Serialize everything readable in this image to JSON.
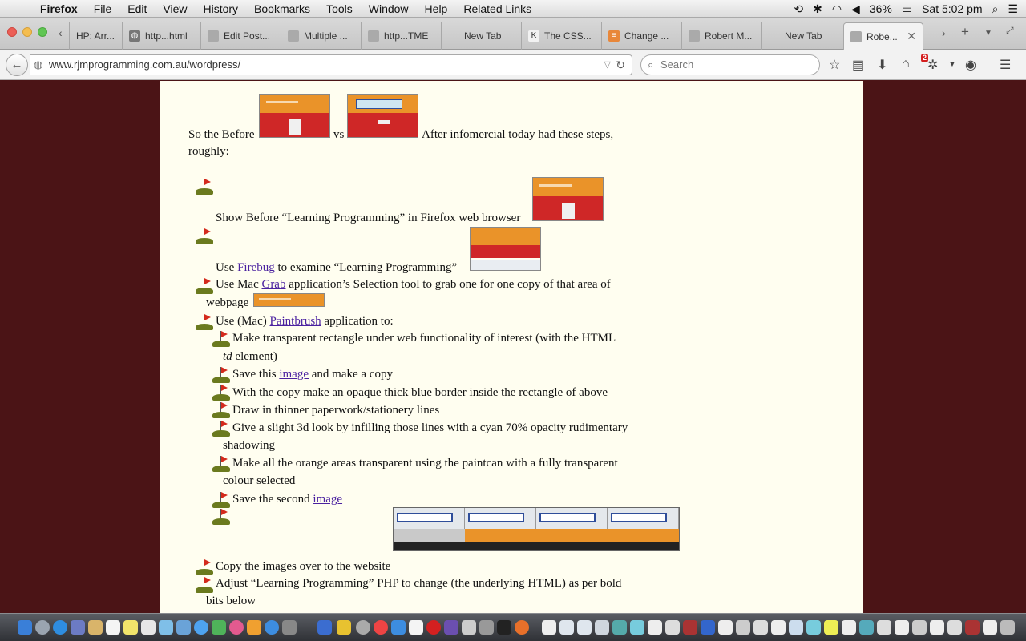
{
  "menubar": {
    "app_name": "Firefox",
    "items": [
      "File",
      "Edit",
      "View",
      "History",
      "Bookmarks",
      "Tools",
      "Window",
      "Help",
      "Related Links"
    ],
    "battery": "36%",
    "clock": "Sat 5:02 pm"
  },
  "tabs": [
    {
      "label": "HP: Arr..."
    },
    {
      "label": "http...html"
    },
    {
      "label": "Edit Post..."
    },
    {
      "label": "Multiple ..."
    },
    {
      "label": "http...TME"
    },
    {
      "label": "New Tab"
    },
    {
      "label": "The CSS..."
    },
    {
      "label": "Change ..."
    },
    {
      "label": "Robert M..."
    },
    {
      "label": "New Tab"
    },
    {
      "label": "Robe..."
    }
  ],
  "navbar": {
    "url": "www.rjmprogramming.com.au/wordpress/",
    "search_placeholder": "Search",
    "badge": "2"
  },
  "article": {
    "intro_1": "So the Before",
    "intro_vs": "vs",
    "intro_2": "After infomercial today had these steps,",
    "intro_3": "roughly:",
    "step1": "Show Before “Learning Programming” in Firefox web browser",
    "step2_pre": "Use",
    "step2_link": "Firebug",
    "step2_post": "to examine “Learning Programming”",
    "step3_pre": "Use Mac",
    "step3_link": "Grab",
    "step3_post": "application’s Selection tool to grab one for one copy of that area of",
    "step3_line2": "webpage",
    "step4_pre": "Use (Mac)",
    "step4_link": "Paintbrush",
    "step4_post": "application to:",
    "sub1_a": "Make transparent rectangle under web functionality of interest (with the HTML",
    "sub1_b_em": "td",
    "sub1_b": "element)",
    "sub2_pre": "Save this",
    "sub2_link": "image",
    "sub2_post": "and make a copy",
    "sub3": "With the copy make an opaque thick blue border inside the rectangle of above",
    "sub4": "Draw in thinner paperwork/stationery lines",
    "sub5_a": "Give a slight 3d look by infilling those lines with a cyan 70% opacity rudimentary",
    "sub5_b": "shadowing",
    "sub6_a": "Make all the orange areas transparent using the paintcan with a fully transparent",
    "sub6_b": "colour selected",
    "sub7_pre": "Save the second",
    "sub7_link": "image",
    "step5": "Copy the images over to the website",
    "step6_a": "Adjust “Learning Programming” PHP to change (the underlying HTML) as per bold",
    "step6_b": "bits below"
  },
  "colors": {
    "page_background": "#4b1416",
    "content_background": "#fffef0",
    "link": "#4b22a0",
    "thumb_orange": "#ea9329",
    "thumb_red": "#cf2727"
  }
}
